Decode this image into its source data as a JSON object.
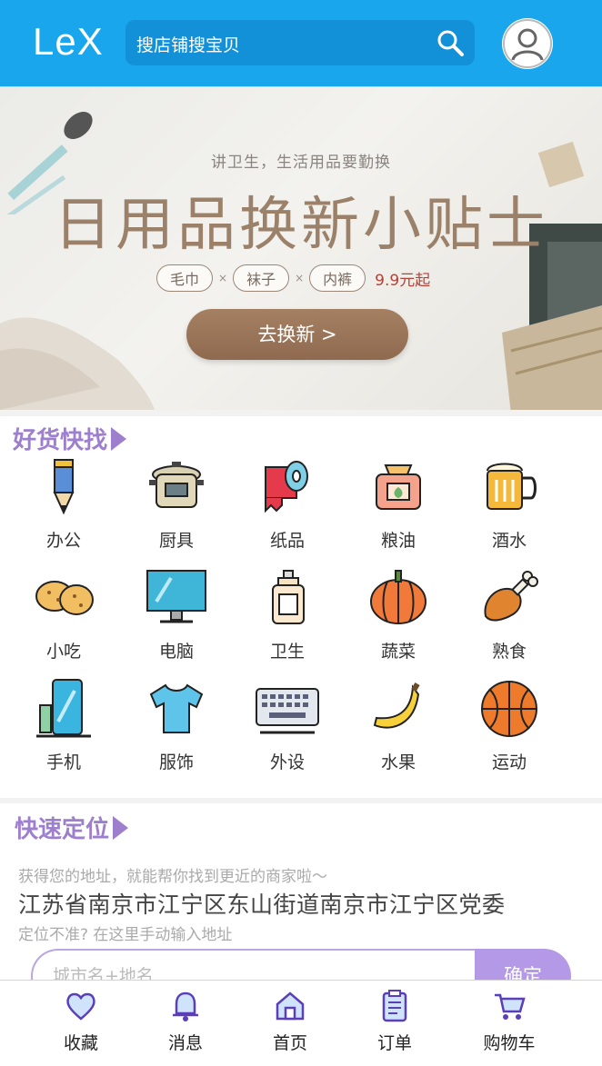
{
  "header": {
    "logo": "LeX",
    "search_placeholder": "搜店铺搜宝贝"
  },
  "banner": {
    "subtitle": "讲卫生，生活用品要勤换",
    "title": "日用品换新小贴士",
    "tags": [
      "毛巾",
      "袜子",
      "内裤"
    ],
    "tag_separator": "×",
    "price": "9.9元起",
    "cta": "去换新 >"
  },
  "categories": {
    "title": "好货快找",
    "items": [
      {
        "label": "办公",
        "icon": "pencil-icon"
      },
      {
        "label": "厨具",
        "icon": "rice-cooker-icon"
      },
      {
        "label": "纸品",
        "icon": "toilet-paper-icon"
      },
      {
        "label": "粮油",
        "icon": "grain-sack-icon"
      },
      {
        "label": "酒水",
        "icon": "beer-mug-icon"
      },
      {
        "label": "小吃",
        "icon": "cookie-icon"
      },
      {
        "label": "电脑",
        "icon": "monitor-icon"
      },
      {
        "label": "卫生",
        "icon": "soap-dispenser-icon"
      },
      {
        "label": "蔬菜",
        "icon": "pumpkin-icon"
      },
      {
        "label": "熟食",
        "icon": "drumstick-icon"
      },
      {
        "label": "手机",
        "icon": "phone-icon"
      },
      {
        "label": "服饰",
        "icon": "tshirt-icon"
      },
      {
        "label": "外设",
        "icon": "keyboard-icon"
      },
      {
        "label": "水果",
        "icon": "banana-icon"
      },
      {
        "label": "运动",
        "icon": "basketball-icon"
      }
    ]
  },
  "location": {
    "title": "快速定位",
    "hint": "获得您的地址，就能帮你找到更近的商家啦～",
    "address": "江苏省南京市江宁区东山街道南京市江宁区党委",
    "manual": "定位不准? 在这里手动输入地址",
    "input_placeholder": "城市名+地名",
    "confirm": "确定"
  },
  "nav": {
    "items": [
      {
        "label": "收藏",
        "icon": "heart-icon"
      },
      {
        "label": "消息",
        "icon": "bell-icon"
      },
      {
        "label": "首页",
        "icon": "home-icon"
      },
      {
        "label": "订单",
        "icon": "clipboard-icon"
      },
      {
        "label": "购物车",
        "icon": "cart-icon"
      }
    ]
  },
  "colors": {
    "header": "#1aa6ec",
    "accent": "#9d7fce",
    "confirm_button": "#b49ae6"
  }
}
